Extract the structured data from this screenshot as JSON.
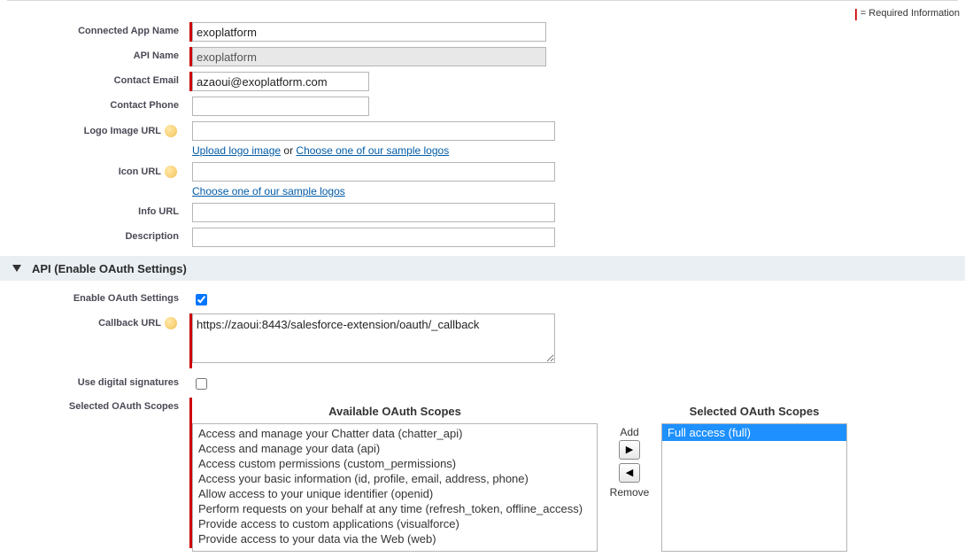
{
  "required_info_label": "= Required Information",
  "fields": {
    "connected_app_name": {
      "label": "Connected App Name",
      "value": "exoplatform"
    },
    "api_name": {
      "label": "API Name",
      "value": "exoplatform"
    },
    "contact_email": {
      "label": "Contact Email",
      "value": "azaoui@exoplatform.com"
    },
    "contact_phone": {
      "label": "Contact Phone",
      "value": ""
    },
    "logo_image_url": {
      "label": "Logo Image URL",
      "value": "",
      "upload_link": "Upload logo image",
      "or": " or ",
      "choose_link": "Choose one of our sample logos"
    },
    "icon_url": {
      "label": "Icon URL",
      "value": "",
      "choose_link": "Choose one of our sample logos"
    },
    "info_url": {
      "label": "Info URL",
      "value": ""
    },
    "description": {
      "label": "Description",
      "value": ""
    }
  },
  "section_api_title": "API (Enable OAuth Settings)",
  "oauth": {
    "enable_label": "Enable OAuth Settings",
    "enable_checked": true,
    "callback_url_label": "Callback URL",
    "callback_url_value": "https://zaoui:8443/salesforce-extension/oauth/_callback",
    "use_digital_sig_label": "Use digital signatures",
    "use_digital_sig_checked": false,
    "selected_scopes_label": "Selected OAuth Scopes",
    "available_title": "Available OAuth Scopes",
    "selected_title": "Selected OAuth Scopes",
    "add_label": "Add",
    "remove_label": "Remove",
    "available_scopes": [
      "Access and manage your Chatter data (chatter_api)",
      "Access and manage your data (api)",
      "Access custom permissions (custom_permissions)",
      "Access your basic information (id, profile, email, address, phone)",
      "Allow access to your unique identifier (openid)",
      "Perform requests on your behalf at any time (refresh_token, offline_access)",
      "Provide access to custom applications (visualforce)",
      "Provide access to your data via the Web (web)"
    ],
    "selected_scopes": [
      {
        "text": "Full access (full)",
        "selected": true
      }
    ]
  }
}
